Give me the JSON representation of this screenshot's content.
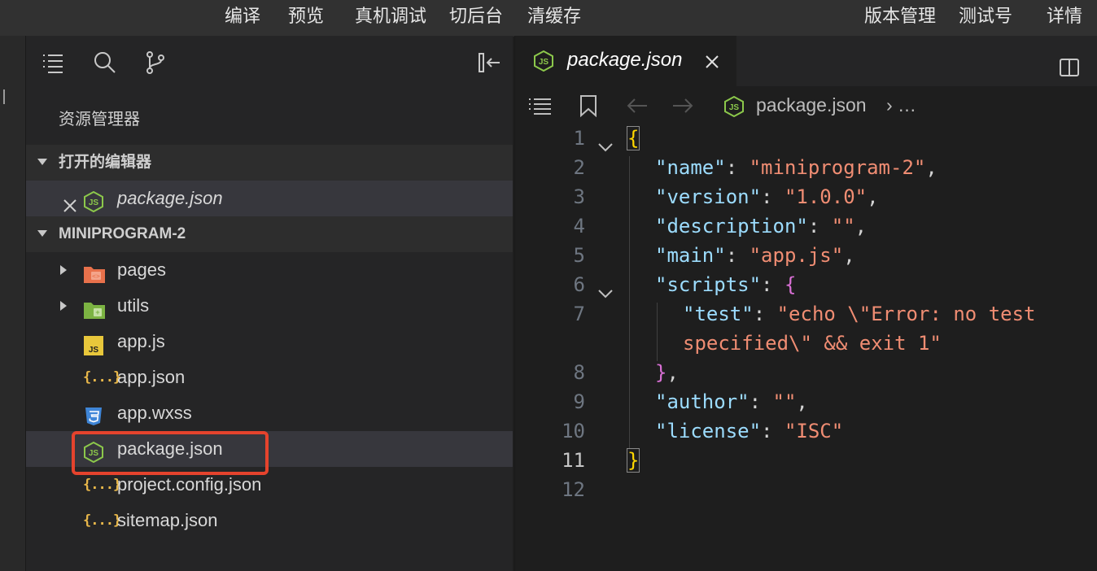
{
  "toolbar": {
    "compile": "编译",
    "preview": "预览",
    "device_debug": "真机调试",
    "background": "切后台",
    "clear_cache": "清缓存",
    "version_mgmt": "版本管理",
    "test_id": "测试号",
    "details": "详情"
  },
  "sidebar": {
    "title": "资源管理器",
    "open_editors_label": "打开的编辑器",
    "open_editors": [
      {
        "name": "package.json",
        "icon": "node-json-icon"
      }
    ],
    "project_label": "MINIPROGRAM-2",
    "files": [
      {
        "name": "pages",
        "type": "folder",
        "icon": "pages-folder-icon"
      },
      {
        "name": "utils",
        "type": "folder",
        "icon": "utils-folder-icon"
      },
      {
        "name": "app.js",
        "type": "file",
        "icon": "js-file-icon"
      },
      {
        "name": "app.json",
        "type": "file",
        "icon": "json-braces-icon"
      },
      {
        "name": "app.wxss",
        "type": "file",
        "icon": "css-file-icon"
      },
      {
        "name": "package.json",
        "type": "file",
        "icon": "node-json-icon",
        "selected": true
      },
      {
        "name": "project.config.json",
        "type": "file",
        "icon": "json-braces-icon"
      },
      {
        "name": "sitemap.json",
        "type": "file",
        "icon": "json-braces-icon"
      }
    ],
    "json_glyph": "{...}",
    "js_glyph": "JS"
  },
  "editor": {
    "tab_label": "package.json",
    "breadcrumb_file": "package.json",
    "breadcrumb_more": "› …",
    "line_numbers": [
      "1",
      "2",
      "3",
      "4",
      "5",
      "6",
      "7",
      "",
      "8",
      "9",
      "10",
      "11",
      "12"
    ],
    "code": {
      "name_key": "\"name\"",
      "name_val": "\"miniprogram-2\"",
      "version_key": "\"version\"",
      "version_val": "\"1.0.0\"",
      "description_key": "\"description\"",
      "description_val": "\"\"",
      "main_key": "\"main\"",
      "main_val": "\"app.js\"",
      "scripts_key": "\"scripts\"",
      "test_key": "\"test\"",
      "test_val_1": "\"echo \\\"Error: no test",
      "test_val_2": "specified\\\" && exit 1\"",
      "author_key": "\"author\"",
      "author_val": "\"\"",
      "license_key": "\"license\"",
      "license_val": "\"ISC\""
    }
  },
  "colors": {
    "accent_highlight": "#e5432d",
    "string": "#f08d73",
    "key": "#9cdcfe",
    "brace_outer": "#ffd700",
    "brace_inner": "#da70d6"
  }
}
